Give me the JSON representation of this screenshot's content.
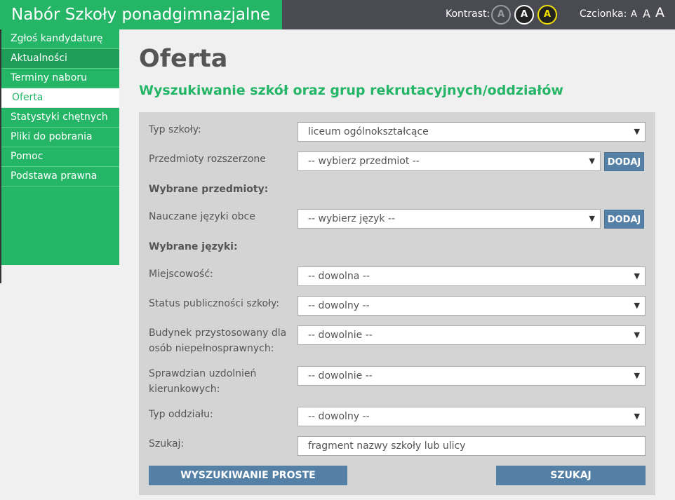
{
  "header": {
    "title": "Nabór Szkoły ponadgimnazjalne",
    "contrast_label": "Kontrast:",
    "contrast_options": [
      "A",
      "A",
      "A"
    ],
    "font_label": "Czcionka:",
    "font_sizes": [
      "A",
      "A",
      "A"
    ]
  },
  "sidebar": {
    "items": [
      {
        "label": "Zgłoś kandydaturę"
      },
      {
        "label": "Aktualności"
      },
      {
        "label": "Terminy naboru"
      },
      {
        "label": "Oferta"
      },
      {
        "label": "Statystyki chętnych"
      },
      {
        "label": "Pliki do pobrania"
      },
      {
        "label": "Pomoc"
      },
      {
        "label": "Podstawa prawna"
      }
    ],
    "active": "Oferta"
  },
  "main": {
    "title": "Oferta",
    "subtitle": "Wyszukiwanie szkół oraz grup rekrutacyjnych/oddziałów"
  },
  "form": {
    "school_type": {
      "label": "Typ szkoły:",
      "value": "liceum ogólnokształcące"
    },
    "subjects": {
      "label": "Przedmioty rozszerzone",
      "value": "-- wybierz przedmiot --",
      "add_label": "DODAJ"
    },
    "selected_subjects_label": "Wybrane przedmioty:",
    "languages": {
      "label": "Nauczane języki obce",
      "value": "-- wybierz język --",
      "add_label": "DODAJ"
    },
    "selected_languages_label": "Wybrane języki:",
    "city": {
      "label": "Miejscowość:",
      "value": "-- dowolna --"
    },
    "public_status": {
      "label": "Status publiczności szkoły:",
      "value": "-- dowolny --"
    },
    "accessible": {
      "label_line1": "Budynek przystosowany dla",
      "label_line2": "osób niepełnosprawnych:",
      "value": "-- dowolnie --"
    },
    "aptitude": {
      "label_line1": "Sprawdzian uzdolnień",
      "label_line2": "kierunkowych:",
      "value": "-- dowolnie --"
    },
    "class_type": {
      "label": "Typ oddziału:",
      "value": "-- dowolny --"
    },
    "search": {
      "label": "Szukaj:",
      "placeholder": "fragment nazwy szkoły lub ulicy"
    },
    "simple_search_label": "WYSZUKIWANIE PROSTE",
    "submit_label": "SZUKAJ"
  }
}
